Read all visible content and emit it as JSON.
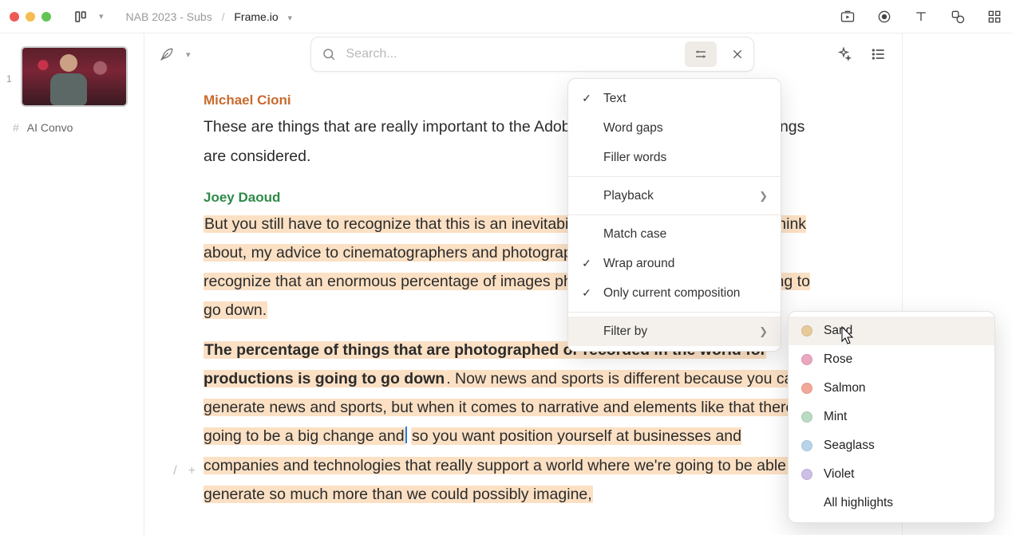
{
  "breadcrumb": {
    "parent": "NAB 2023 - Subs",
    "leaf": "Frame.io"
  },
  "sidebar": {
    "thumb_index": "1",
    "hash_label": "AI Convo"
  },
  "search": {
    "placeholder": "Search..."
  },
  "transcript": {
    "sp1": "Michael Cioni",
    "p1": "These are things that are really important to the Adobe brand. And so all of these things are considered.",
    "sp2": "Joey Daoud",
    "p2a": "But you still have to recognize that this is an inevitability. So while everyone has to think about, my advice to cinematographers and photographers in general, is to really recognize that an enormous percentage of images photographed or recorded is going to go down.",
    "p3_bold": "The percentage of things that are photographed or recorded in the world for productions is going to go down",
    "p3_rest_a": ". Now news and sports is different because you can't generate news and sports, but when it comes to narrative and elements like that there's going to be a big change and",
    "p3_rest_b": "so you want position yourself at businesses and companies and technologies that really support a world where we're going to be able to generate so much more than we could possibly imagine,"
  },
  "menu": {
    "text": "Text",
    "word_gaps": "Word gaps",
    "filler": "Filler words",
    "playback": "Playback",
    "match": "Match case",
    "wrap": "Wrap around",
    "only": "Only current composition",
    "filter": "Filter by"
  },
  "colors": [
    {
      "name": "Sand",
      "hex": "#e8c99a"
    },
    {
      "name": "Rose",
      "hex": "#e9a7c0"
    },
    {
      "name": "Salmon",
      "hex": "#f2a896"
    },
    {
      "name": "Mint",
      "hex": "#b9dcc2"
    },
    {
      "name": "Seaglass",
      "hex": "#b9d3e8"
    },
    {
      "name": "Violet",
      "hex": "#cdbfe8"
    }
  ],
  "all_highlights": "All highlights"
}
